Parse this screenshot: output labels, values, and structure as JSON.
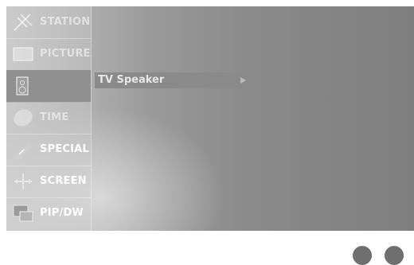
{
  "menu": {
    "items": [
      {
        "label": "STATION",
        "icon": "antenna-icon"
      },
      {
        "label": "PICTURE",
        "icon": "picture-icon"
      },
      {
        "label": "",
        "icon": "speaker-icon"
      },
      {
        "label": "TIME",
        "icon": "clock-icon"
      },
      {
        "label": "SPECIAL",
        "icon": "special-icon"
      },
      {
        "label": "SCREEN",
        "icon": "screen-icon"
      },
      {
        "label": "PIP/DW",
        "icon": "pip-icon"
      }
    ]
  },
  "submenu": {
    "label": "TV Speaker",
    "arrow_icon": "right-arrow-icon"
  },
  "colors": {
    "menu_text": "#ffffff",
    "highlight": "#8a8a8a",
    "dots": "#6f6f6f"
  }
}
